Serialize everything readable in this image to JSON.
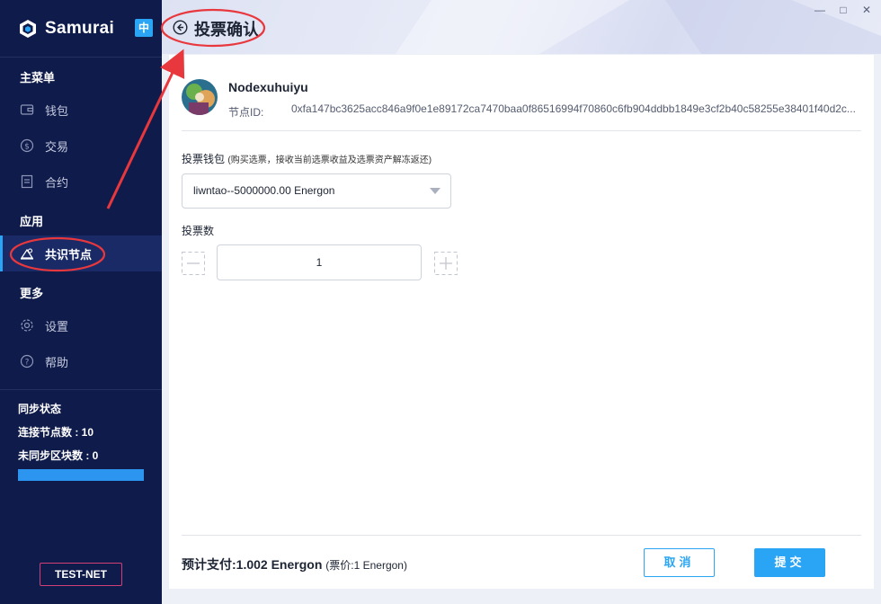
{
  "app": {
    "name": "Samurai",
    "lang_toggle": "中"
  },
  "sidebar": {
    "groups": [
      {
        "title": "主菜单",
        "items": [
          {
            "label": "钱包",
            "icon": "wallet-icon"
          },
          {
            "label": "交易",
            "icon": "dollar-icon"
          },
          {
            "label": "合约",
            "icon": "contract-icon"
          }
        ]
      },
      {
        "title": "应用",
        "items": [
          {
            "label": "共识节点",
            "icon": "node-icon",
            "active": true
          }
        ]
      },
      {
        "title": "更多",
        "items": [
          {
            "label": "设置",
            "icon": "gear-icon"
          },
          {
            "label": "帮助",
            "icon": "help-icon"
          }
        ]
      }
    ],
    "sync": {
      "title": "同步状态",
      "connected_nodes": "连接节点数 : 10",
      "unsynced_blocks": "未同步区块数 : 0",
      "progress": 1.0
    },
    "network_badge": "TEST-NET"
  },
  "header": {
    "title": "投票确认"
  },
  "node": {
    "name": "Nodexuhuiyu",
    "id_label": "节点ID:",
    "id_value": "0xfa147bc3625acc846a9f0e1e89172ca7470baa0f86516994f70860c6fb904ddbb1849e3cf2b40c58255e38401f40d2c..."
  },
  "form": {
    "wallet_label": "投票钱包",
    "wallet_hint": "(购买选票，接收当前选票收益及选票资产解冻返还)",
    "wallet_selected": "liwntao--5000000.00 Energon",
    "votes_label": "投票数",
    "votes_value": "1"
  },
  "footer": {
    "estimated_cost": "预计支付:1.002 Energon",
    "price_note": "(票价:1 Energon)",
    "cancel": "取消",
    "submit": "提交"
  },
  "colors": {
    "sidebar_bg": "#0f1b4a",
    "accent": "#2aa4f4",
    "annotation": "#e8383d",
    "testnet_border": "#d23f76"
  }
}
